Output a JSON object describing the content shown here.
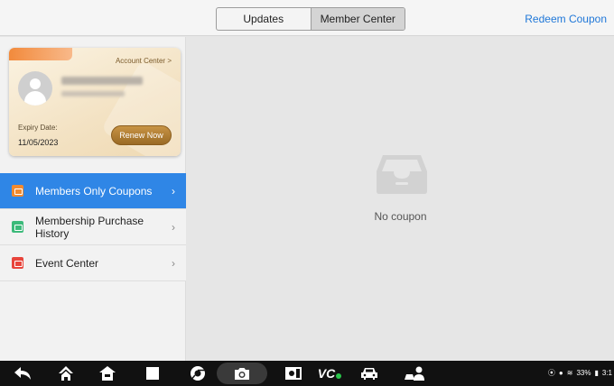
{
  "header": {
    "tabs": [
      {
        "label": "Updates",
        "active": false
      },
      {
        "label": "Member Center",
        "active": true
      }
    ],
    "redeem_label": "Redeem Coupon"
  },
  "member_card": {
    "account_center_label": "Account Center >",
    "expiry_label": "Expiry Date:",
    "expiry_value": "11/05/2023",
    "renew_label": "Renew Now"
  },
  "sidebar": {
    "items": [
      {
        "label": "Members Only Coupons",
        "icon": "coupon-icon",
        "color": "#f28a2e",
        "active": true
      },
      {
        "label": "Membership Purchase History",
        "icon": "purchase-history-icon",
        "color": "#3cba7a",
        "active": false
      },
      {
        "label": "Event Center",
        "icon": "event-icon",
        "color": "#e8453c",
        "active": false
      }
    ]
  },
  "main": {
    "empty_icon": "empty-tray-icon",
    "empty_text": "No coupon"
  },
  "navbar": {
    "icons": [
      "back-icon",
      "home-icon",
      "house-icon",
      "recents-icon",
      "browser-icon",
      "camera-icon",
      "screen-brightness-icon",
      "vci-icon",
      "car-icon",
      "remote-expert-icon"
    ],
    "status": {
      "battery": "33%",
      "time": "3:1"
    }
  },
  "colors": {
    "accent": "#2f86e6",
    "link": "#1f77d8",
    "renew_button": "#b07d35"
  }
}
